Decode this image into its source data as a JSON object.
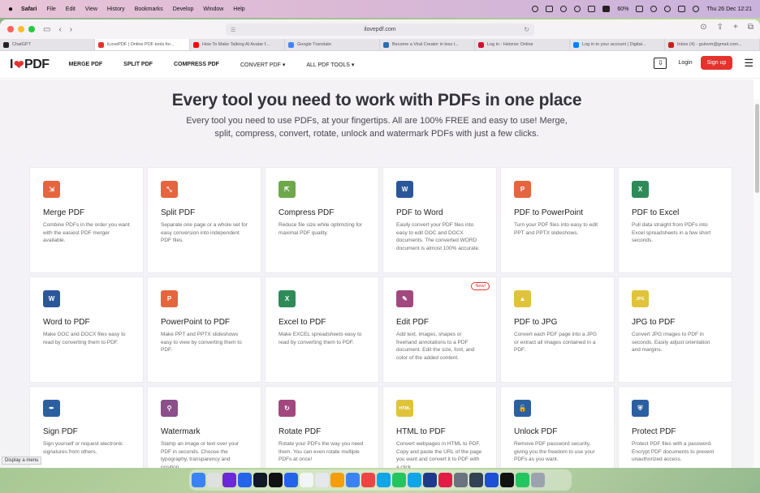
{
  "menubar": {
    "apple": "",
    "items": [
      "Safari",
      "File",
      "Edit",
      "View",
      "History",
      "Bookmarks",
      "Develop",
      "Window",
      "Help"
    ],
    "battery": "60%",
    "clock": "Thu 26 Dec 12:21"
  },
  "browser": {
    "address": "ilovepdf.com",
    "tabs": [
      {
        "label": "ChatGPT",
        "color": "#222"
      },
      {
        "label": "iLovePDF | Online PDF tools for...",
        "color": "#e5322d"
      },
      {
        "label": "How To Make Talking AI Avatar f...",
        "color": "#ff0000"
      },
      {
        "label": "Google Translate",
        "color": "#4285f4"
      },
      {
        "label": "Become a Viral Creator in less t...",
        "color": "#2b6cb0"
      },
      {
        "label": "Log in - Hetzner Online",
        "color": "#d50c2d"
      },
      {
        "label": "Log in to your account | Digital...",
        "color": "#0080ff"
      },
      {
        "label": "Inbox (4) - gulovm@gmail.com...",
        "color": "#c5221f"
      }
    ]
  },
  "site": {
    "logo_a": "I",
    "logo_heart": "❤",
    "logo_b": "PDF",
    "nav": [
      "MERGE PDF",
      "SPLIT PDF",
      "COMPRESS PDF",
      "CONVERT PDF ▾",
      "ALL PDF TOOLS ▾"
    ],
    "login": "Login",
    "signup": "Sign up"
  },
  "hero": {
    "title": "Every tool you need to work with PDFs in one place",
    "subtitle_line1": "Every tool you need to use PDFs, at your fingertips. All are 100% FREE and easy to use! Merge,",
    "subtitle_line2": "split, compress, convert, rotate, unlock and watermark PDFs with just a few clicks."
  },
  "tools": [
    {
      "title": "Merge PDF",
      "desc": "Combine PDFs in the order you want with the easiest PDF merger available.",
      "color": "#e5653f",
      "glyph": "⇲"
    },
    {
      "title": "Split PDF",
      "desc": "Separate one page or a whole set for easy conversion into independent PDF files.",
      "color": "#e5653f",
      "glyph": "⤡"
    },
    {
      "title": "Compress PDF",
      "desc": "Reduce file size while optimizing for maximal PDF quality.",
      "color": "#6fa84a",
      "glyph": "⇱"
    },
    {
      "title": "PDF to Word",
      "desc": "Easily convert your PDF files into easy to edit DOC and DOCX documents. The converted WORD document is almost 100% accurate.",
      "color": "#2b579a",
      "glyph": "W"
    },
    {
      "title": "PDF to PowerPoint",
      "desc": "Turn your PDF files into easy to edit PPT and PPTX slideshows.",
      "color": "#e5653f",
      "glyph": "P"
    },
    {
      "title": "PDF to Excel",
      "desc": "Pull data straight from PDFs into Excel spreadsheets in a few short seconds.",
      "color": "#2e8b57",
      "glyph": "X"
    },
    {
      "title": "Word to PDF",
      "desc": "Make DOC and DOCX files easy to read by converting them to PDF.",
      "color": "#2b579a",
      "glyph": "W"
    },
    {
      "title": "PowerPoint to PDF",
      "desc": "Make PPT and PPTX slideshows easy to view by converting them to PDF.",
      "color": "#e5653f",
      "glyph": "P"
    },
    {
      "title": "Excel to PDF",
      "desc": "Make EXCEL spreadsheets easy to read by converting them to PDF.",
      "color": "#2e8b57",
      "glyph": "X"
    },
    {
      "title": "Edit PDF",
      "desc": "Add text, images, shapes or freehand annotations to a PDF document. Edit the size, font, and color of the added content.",
      "color": "#a3487f",
      "glyph": "✎",
      "badge": "New!"
    },
    {
      "title": "PDF to JPG",
      "desc": "Convert each PDF page into a JPG or extract all images contained in a PDF.",
      "color": "#e0c33a",
      "glyph": "▲"
    },
    {
      "title": "JPG to PDF",
      "desc": "Convert JPG images to PDF in seconds. Easily adjust orientation and margins.",
      "color": "#e0c33a",
      "glyph": "JPG"
    },
    {
      "title": "Sign PDF",
      "desc": "Sign yourself or request electronic signatures from others.",
      "color": "#2b5fa0",
      "glyph": "✒"
    },
    {
      "title": "Watermark",
      "desc": "Stamp an image or text over your PDF in seconds. Choose the typography, transparency and position.",
      "color": "#8b4f8a",
      "glyph": "⚲"
    },
    {
      "title": "Rotate PDF",
      "desc": "Rotate your PDFs the way you need them. You can even rotate multiple PDFs at once!",
      "color": "#a3487f",
      "glyph": "↻"
    },
    {
      "title": "HTML to PDF",
      "desc": "Convert webpages in HTML to PDF. Copy and paste the URL of the page you want and convert it to PDF with a click.",
      "color": "#e0c33a",
      "glyph": "HTML"
    },
    {
      "title": "Unlock PDF",
      "desc": "Remove PDF password security, giving you the freedom to use your PDFs as you want.",
      "color": "#2b5fa0",
      "glyph": "🔓"
    },
    {
      "title": "Protect PDF",
      "desc": "Protect PDF files with a password. Encrypt PDF documents to prevent unauthorized access.",
      "color": "#2b5fa0",
      "glyph": "⛨"
    }
  ],
  "status_bar": "Display a menu",
  "dock_colors": [
    "#3b82f6",
    "#e0e0e0",
    "#6d28d9",
    "#2563eb",
    "#111827",
    "#111",
    "#2563eb",
    "#f3f4f6",
    "#e5e7eb",
    "#f59e0b",
    "#3b82f6",
    "#ef4444",
    "#0ea5e9",
    "#22c55e",
    "#0ea5e9",
    "#1e3a8a",
    "#e11d48",
    "#6b7280",
    "#334155",
    "#1d4ed8",
    "#111",
    "#22c55e",
    "#9ca3af"
  ]
}
